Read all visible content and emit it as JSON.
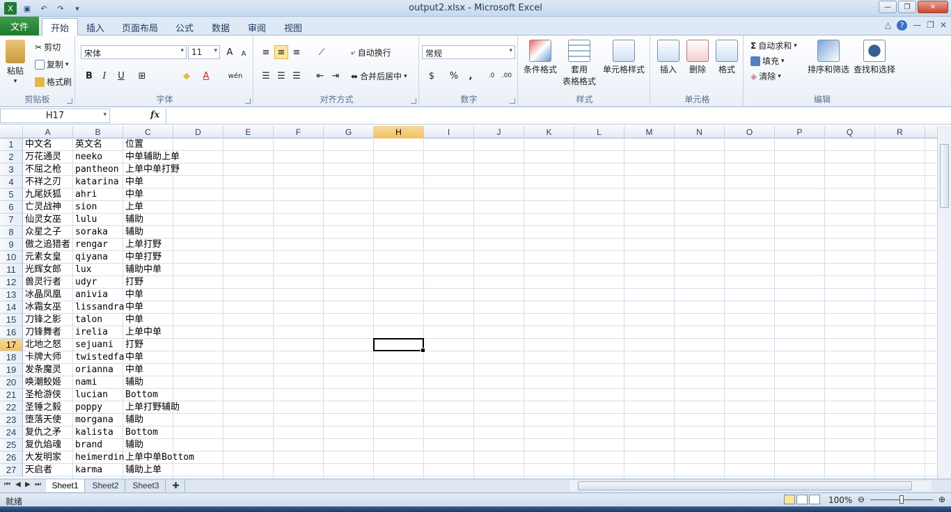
{
  "window": {
    "title": "output2.xlsx - Microsoft Excel"
  },
  "ribbon_tabs": [
    {
      "label": "文件"
    },
    {
      "label": "开始"
    },
    {
      "label": "插入"
    },
    {
      "label": "页面布局"
    },
    {
      "label": "公式"
    },
    {
      "label": "数据"
    },
    {
      "label": "审阅"
    },
    {
      "label": "视图"
    }
  ],
  "clipboard": {
    "paste": "粘贴",
    "cut": "剪切",
    "copy": "复制",
    "format_painter": "格式刷",
    "group": "剪贴板"
  },
  "font": {
    "name": "宋体",
    "size": "11",
    "bold": "B",
    "italic": "I",
    "underline": "U",
    "group": "字体"
  },
  "alignment": {
    "wrap": "自动换行",
    "merge": "合并后居中",
    "group": "对齐方式"
  },
  "number": {
    "format": "常规",
    "currency": "$",
    "percent": "%",
    "comma": ",",
    "group": "数字"
  },
  "styles": {
    "conditional": "条件格式",
    "table": "套用",
    "table2": "表格格式",
    "cell_styles": "单元格样式",
    "group": "样式"
  },
  "cells": {
    "insert": "插入",
    "delete": "删除",
    "format": "格式",
    "group": "单元格"
  },
  "editing": {
    "autosum": "自动求和",
    "fill": "填充",
    "clear": "清除",
    "sort": "排序和筛选",
    "find": "查找和选择",
    "group": "编辑"
  },
  "name_box": "H17",
  "fx_label": "fx",
  "columns": [
    "A",
    "B",
    "C",
    "D",
    "E",
    "F",
    "G",
    "H",
    "I",
    "J",
    "K",
    "L",
    "M",
    "N",
    "O",
    "P",
    "Q",
    "R"
  ],
  "selected_column": "H",
  "selected_row": 17,
  "rows": [
    {
      "n": "1",
      "a": "中文名",
      "b": "英文名",
      "c": "位置"
    },
    {
      "n": "2",
      "a": "万花通灵",
      "b": "neeko",
      "c": "中单辅助上单"
    },
    {
      "n": "3",
      "a": "不屈之枪",
      "b": "pantheon",
      "c": "上单中单打野"
    },
    {
      "n": "4",
      "a": "不祥之刃",
      "b": "katarina",
      "c": "中单"
    },
    {
      "n": "5",
      "a": "九尾妖狐",
      "b": "ahri",
      "c": "中单"
    },
    {
      "n": "6",
      "a": "亡灵战神",
      "b": "sion",
      "c": "上单"
    },
    {
      "n": "7",
      "a": "仙灵女巫",
      "b": "lulu",
      "c": "辅助"
    },
    {
      "n": "8",
      "a": "众星之子",
      "b": "soraka",
      "c": "辅助"
    },
    {
      "n": "9",
      "a": "傲之追猎者",
      "b": "rengar",
      "c": "上单打野"
    },
    {
      "n": "10",
      "a": "元素女皇",
      "b": "qiyana",
      "c": "中单打野"
    },
    {
      "n": "11",
      "a": "光辉女郎",
      "b": "lux",
      "c": "辅助中单"
    },
    {
      "n": "12",
      "a": "兽灵行者",
      "b": "udyr",
      "c": "打野"
    },
    {
      "n": "13",
      "a": "冰晶凤凰",
      "b": "anivia",
      "c": "中单"
    },
    {
      "n": "14",
      "a": "冰霜女巫",
      "b": "lissandra",
      "c": "中单"
    },
    {
      "n": "15",
      "a": "刀锋之影",
      "b": "talon",
      "c": "中单"
    },
    {
      "n": "16",
      "a": "刀锋舞者",
      "b": "irelia",
      "c": "上单中单"
    },
    {
      "n": "17",
      "a": "北地之怒",
      "b": "sejuani",
      "c": "打野"
    },
    {
      "n": "18",
      "a": "卡牌大师",
      "b": "twistedfa",
      "c": "中单"
    },
    {
      "n": "19",
      "a": "发条魔灵",
      "b": "orianna",
      "c": "中单"
    },
    {
      "n": "20",
      "a": "唤潮鲛姬",
      "b": "nami",
      "c": "辅助"
    },
    {
      "n": "21",
      "a": "圣枪游侠",
      "b": "lucian",
      "c": "Bottom"
    },
    {
      "n": "22",
      "a": "圣锤之毅",
      "b": "poppy",
      "c": "上单打野辅助"
    },
    {
      "n": "23",
      "a": "堕落天使",
      "b": "morgana",
      "c": "辅助"
    },
    {
      "n": "24",
      "a": "复仇之矛",
      "b": "kalista",
      "c": "Bottom"
    },
    {
      "n": "25",
      "a": "复仇焰魂",
      "b": "brand",
      "c": "辅助"
    },
    {
      "n": "26",
      "a": "大发明家",
      "b": "heimerdin",
      "c": "上单中单Bottom"
    },
    {
      "n": "27",
      "a": "天启者",
      "b": "karma",
      "c": "辅助上单"
    }
  ],
  "sheets": [
    "Sheet1",
    "Sheet2",
    "Sheet3"
  ],
  "active_sheet": "Sheet1",
  "status": "就绪",
  "zoom": "100%"
}
